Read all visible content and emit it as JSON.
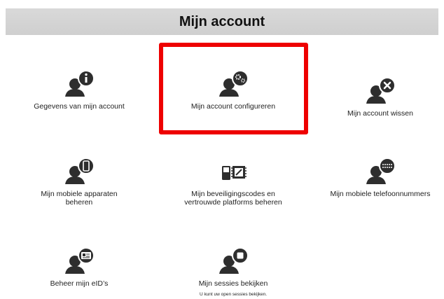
{
  "header": {
    "title": "Mijn account"
  },
  "tiles": [
    {
      "label": "Gegevens van mijn account",
      "icon": "user-info-icon"
    },
    {
      "label": "Mijn account configureren",
      "icon": "user-settings-icon"
    },
    {
      "label": "Mijn account wissen",
      "icon": "user-delete-icon"
    },
    {
      "label": "Mijn mobiele apparaten beheren",
      "icon": "user-mobile-icon"
    },
    {
      "label": "Mijn beveiligingscodes en vertrouwde platforms beheren",
      "icon": "security-chip-icon"
    },
    {
      "label": "Mijn mobiele telefoonnummers",
      "icon": "user-phone-number-icon"
    },
    {
      "label": "Beheer mijn eID’s",
      "icon": "user-eid-card-icon"
    },
    {
      "label": "Mijn sessies bekijken",
      "icon": "user-session-icon",
      "sub": "U kunt uw open sessies bekijken."
    }
  ],
  "colors": {
    "highlight": "#ee0000",
    "header_bg": "#d5d5d5",
    "icon": "#2e2e2e"
  }
}
